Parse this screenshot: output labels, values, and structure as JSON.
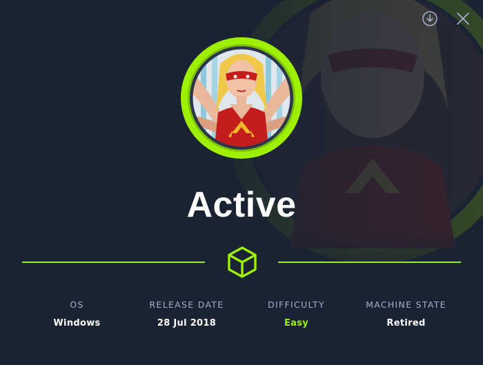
{
  "machine": {
    "name": "Active"
  },
  "toolbar": {
    "download_icon": "download-circle-icon",
    "close_icon": "close-icon"
  },
  "stats": [
    {
      "label": "OS",
      "value": "Windows"
    },
    {
      "label": "RELEASE DATE",
      "value": "28 Jul 2018"
    },
    {
      "label": "DIFFICULTY",
      "value": "Easy"
    },
    {
      "label": "MACHINE STATE",
      "value": "Retired"
    }
  ],
  "colors": {
    "accent": "#9fef00",
    "background": "#1a2332",
    "label": "#a4b1cd",
    "text": "#ffffff"
  }
}
